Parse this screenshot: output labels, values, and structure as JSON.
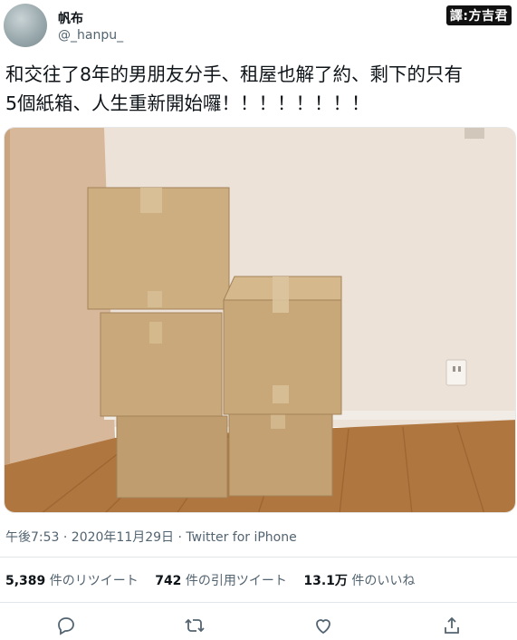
{
  "tweet": {
    "author_name": "帆布",
    "author_handle": "@_hanpu_",
    "translator_badge": "譯:方吉君",
    "text_line1": "和交往了8年的男朋友分手、租屋也解了約、剩下的只有",
    "text_line2": "5個紙箱、人生重新開始囉！！！！！！！！",
    "timestamp": "午後7:53 · 2020年11月29日 · Twitter for iPhone"
  },
  "stats": {
    "retweets_count": "5,389",
    "retweets_label": "件のリツイート",
    "quotes_count": "742",
    "quotes_label": "件の引用ツイート",
    "likes_count": "13.1万",
    "likes_label": "件のいいね"
  },
  "photo": {
    "description_icon": "photo-of-cardboard-boxes"
  },
  "actions": {
    "icons": [
      "reply-icon",
      "retweet-icon",
      "like-icon",
      "share-icon"
    ]
  },
  "colors": {
    "text": "#0f1419",
    "secondary": "#536471",
    "divider": "#e1e6ea",
    "wall": "#e8ddd2",
    "floor": "#a9703e",
    "box": "#c7a77a"
  }
}
